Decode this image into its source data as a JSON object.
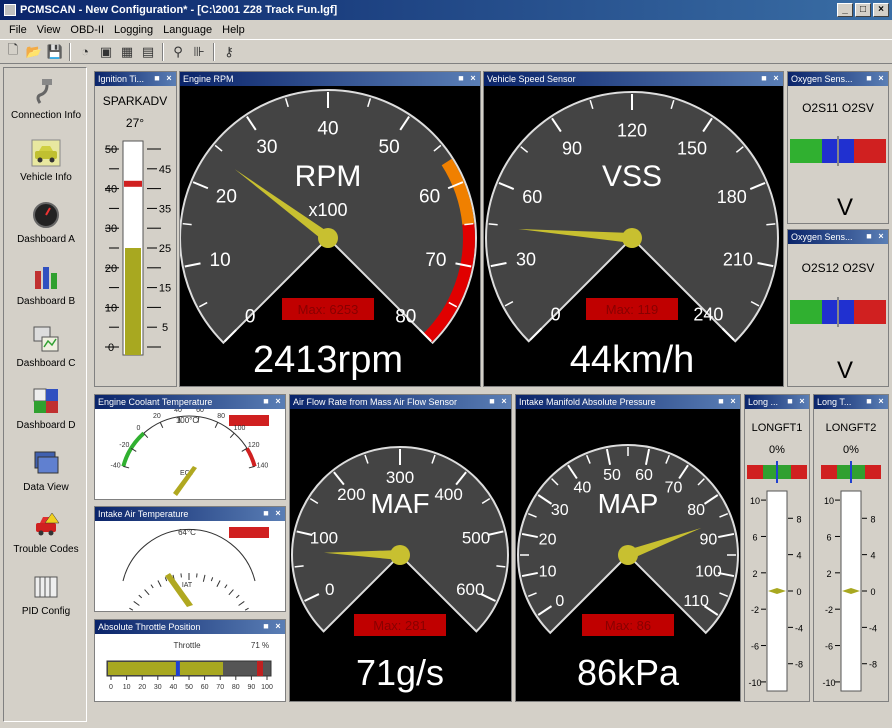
{
  "window": {
    "title": "PCMSCAN - New Configuration* - [C:\\2001 Z28 Track Fun.lgf]"
  },
  "menu": [
    "File",
    "View",
    "OBD-II",
    "Logging",
    "Language",
    "Help"
  ],
  "sidebar": [
    {
      "label": "Connection Info",
      "icon": "connection-icon"
    },
    {
      "label": "Vehicle Info",
      "icon": "car-icon"
    },
    {
      "label": "Dashboard A",
      "icon": "gauge-icon"
    },
    {
      "label": "Dashboard B",
      "icon": "bar-gauge-icon"
    },
    {
      "label": "Dashboard C",
      "icon": "chart-icon"
    },
    {
      "label": "Dashboard D",
      "icon": "grid-icon"
    },
    {
      "label": "Data View",
      "icon": "data-view-icon"
    },
    {
      "label": "Trouble Codes",
      "icon": "trouble-codes-icon"
    },
    {
      "label": "PID Config",
      "icon": "pid-config-icon"
    }
  ],
  "panels": {
    "ignition": {
      "title": "Ignition Ti...",
      "pid": "SPARKADV",
      "value": "27°",
      "ticks": [
        "50",
        "45",
        "40",
        "35",
        "30",
        "25",
        "20",
        "15",
        "10",
        "5",
        "0"
      ],
      "fill_fraction": 0.5,
      "max_fraction": 0.8
    },
    "rpm": {
      "title": "Engine RPM",
      "label": "RPM",
      "multiplier": "x100",
      "max": "Max: 6253",
      "reading": "2413rpm",
      "ticks": [
        "0",
        "10",
        "20",
        "30",
        "40",
        "50",
        "60",
        "70",
        "80"
      ],
      "needle_value": 24.13,
      "range": [
        0,
        80
      ],
      "redline_from": 65
    },
    "vss": {
      "title": "Vehicle Speed Sensor",
      "label": "VSS",
      "max": "Max: 119",
      "reading": "44km/h",
      "ticks": [
        "0",
        "30",
        "60",
        "90",
        "120",
        "150",
        "180",
        "210",
        "240"
      ],
      "needle_value": 44,
      "range": [
        0,
        240
      ]
    },
    "o2s11": {
      "title": "Oxygen Sens...",
      "pid": "O2S11 O2SV",
      "unit": "V"
    },
    "o2s12": {
      "title": "Oxygen Sens...",
      "pid": "O2S12 O2SV",
      "unit": "V"
    },
    "ect": {
      "title": "Engine Coolant Temperature",
      "value": "100°C",
      "pid": "ECT",
      "ticks": [
        "-40",
        "-20",
        "0",
        "20",
        "40",
        "60",
        "80",
        "100",
        "120",
        "140"
      ]
    },
    "iat": {
      "title": "Intake Air Temperature",
      "value": "64°C",
      "pid": "IAT"
    },
    "tps": {
      "title": "Absolute Throttle Position",
      "pid": "Throttle",
      "value": "71 %",
      "ticks": [
        "0",
        "10",
        "20",
        "30",
        "40",
        "50",
        "60",
        "70",
        "80",
        "90",
        "100"
      ],
      "fill_fraction": 0.71
    },
    "maf": {
      "title": "Air Flow Rate from Mass Air Flow Sensor",
      "label": "MAF",
      "max": "Max: 281",
      "reading": "71g/s",
      "ticks": [
        "0",
        "100",
        "200",
        "300",
        "400",
        "500",
        "600"
      ],
      "needle_value": 71,
      "range": [
        -50,
        650
      ]
    },
    "map": {
      "title": "Intake Manifold Absolute Pressure",
      "label": "MAP",
      "max": "Max: 86",
      "reading": "86kPa",
      "ticks": [
        "0",
        "10",
        "20",
        "30",
        "40",
        "50",
        "60",
        "70",
        "80",
        "90",
        "100",
        "110"
      ],
      "needle_value": 86,
      "range": [
        -5,
        115
      ]
    },
    "longft1": {
      "title": "Long ...",
      "pid": "LONGFT1",
      "value": "0%",
      "ticks_left": [
        "10",
        "6",
        "2",
        "-2",
        "-6",
        "-10"
      ],
      "ticks_right": [
        "8",
        "4",
        "0",
        "-4",
        "-8"
      ]
    },
    "longft2": {
      "title": "Long T...",
      "pid": "LONGFT2",
      "value": "0%",
      "ticks_left": [
        "10",
        "6",
        "2",
        "-2",
        "-6",
        "-10"
      ],
      "ticks_right": [
        "8",
        "4",
        "0",
        "-4",
        "-8"
      ]
    }
  },
  "colors": {
    "gauge_face": "#444444",
    "needle": "#c8c030",
    "redline": "#e00000",
    "orange": "#f08000",
    "max_box": "#c00000"
  }
}
